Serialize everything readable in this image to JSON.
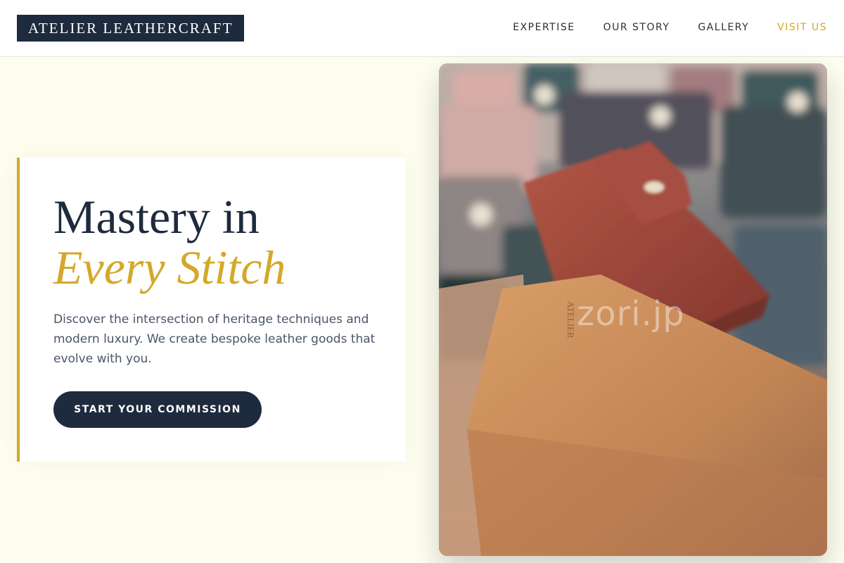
{
  "header": {
    "logo": "ATELIER LEATHERCRAFT",
    "nav": [
      {
        "label": "EXPERTISE"
      },
      {
        "label": "OUR STORY"
      },
      {
        "label": "GALLERY"
      },
      {
        "label": "VISIT US"
      }
    ]
  },
  "hero": {
    "title_line1": "Mastery in",
    "title_line2": "Every Stitch",
    "description": "Discover the intersection of heritage techniques and modern luxury. We create bespoke leather goods that evolve with you.",
    "cta_label": "START YOUR COMMISSION"
  },
  "image": {
    "watermark": "zori.jp",
    "embossed_brand": "ATELIER"
  },
  "colors": {
    "navy": "#1e2a3d",
    "gold": "#d4a82a",
    "background": "#fefef0"
  }
}
